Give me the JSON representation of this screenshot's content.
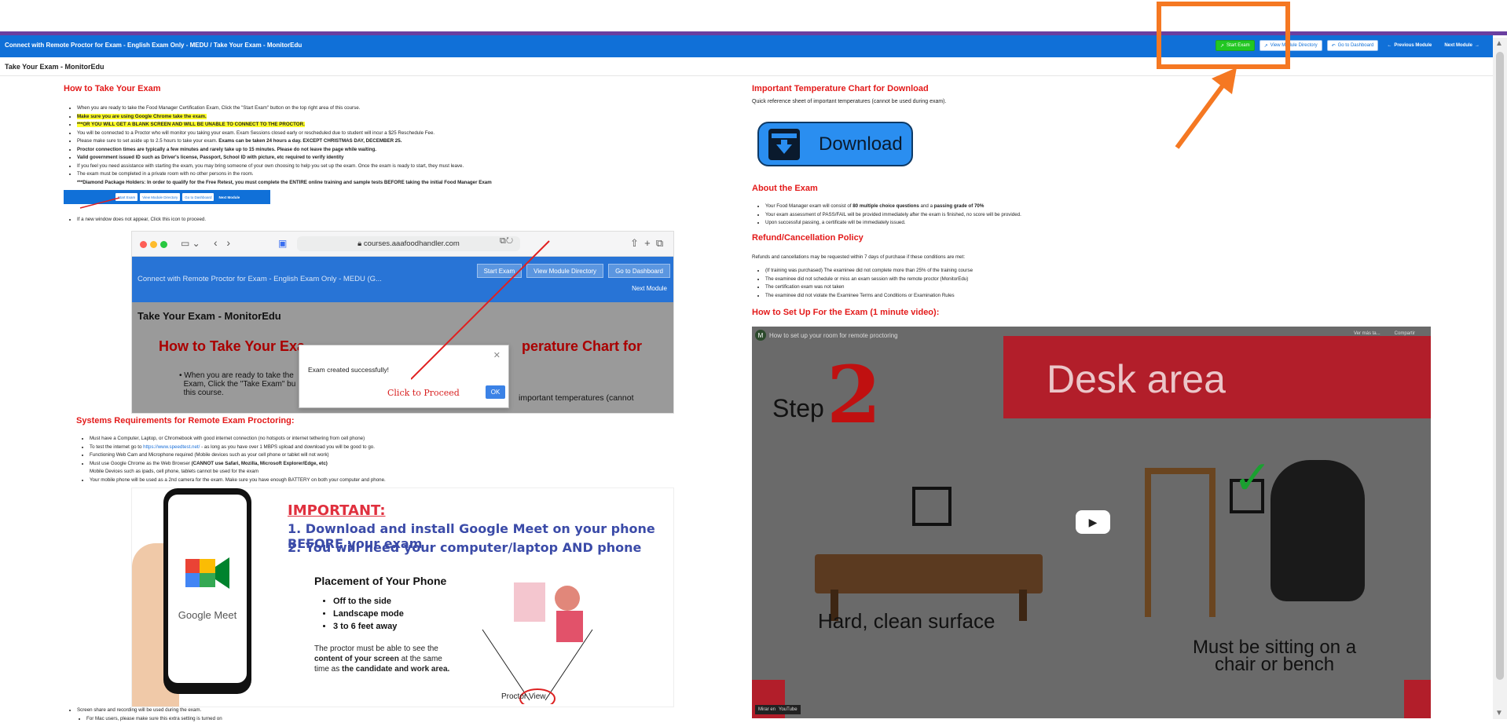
{
  "header": {
    "course_title": "Connect with Remote Proctor for Exam - English Exam Only - MEDU / Take Your Exam - MonitorEdu",
    "buttons": {
      "start_exam": "Start Exam",
      "view_module_directory": "View Module Directory",
      "go_to_dashboard": "Go to Dashboard",
      "previous_module": "Previous Module",
      "next_module": "Next Module"
    }
  },
  "page_title": "Take Your Exam - MonitorEdu",
  "left": {
    "how_to_heading": "How to Take Your Exam",
    "how_to_bullets": [
      "When you are ready to take the Food Manager Certification Exam, Click the \"Start Exam\" button on the top right area of this course.",
      "Make sure you are using Google Chrome take the exam.",
      "***OR YOU WILL GET A BLANK SCREEN AND WILL BE UNABLE TO CONNECT TO THE PROCTOR.",
      "You will be connected to a Proctor who will monitor you taking your exam. Exam Sessions closed early or rescheduled due to student will incur a $25 Reschedule Fee.",
      "Please make sure to set aside up to 2.5 hours to take your exam.",
      "Exams can be taken 24 hours a day. EXCEPT CHRISTMAS DAY, DECEMBER 25.",
      "Proctor connection times are typically a few minutes and rarely take up to 15 minutes. Please do not leave the page while waiting.",
      "Valid government issued ID such as Driver's license, Passport, School ID with picture, etc required to verify identity",
      "If you feel you need assistance with starting the exam, you may bring someone of your own choosing to help you set up the exam. Once the exam is ready to start, they must leave.",
      "The exam must be completed in a private room with no other persons in the room.",
      "***Diamond Package Holders: In order to qualify for the Free Retest, you must complete the ENTIRE online training and sample tests BEFORE taking the initial Food Manager Exam"
    ],
    "mini_toolbar": {
      "start_exam": "Start Exam",
      "view_module_directory": "View Module Directory",
      "go_to_dashboard": "Go to Dashboard",
      "next_module": "Next Module"
    },
    "new_window_note": "If a new window does not appear, Click this icon to proceed.",
    "browser": {
      "url": "courses.aaafoodhandler.com",
      "blue_title": "Connect with Remote Proctor for Exam - English Exam Only - MEDU (G...",
      "start_exam": "Start Exam",
      "view_module_directory": "View Module Directory",
      "go_to_dashboard": "Go to Dashboard",
      "next_module": "Next Module",
      "page_title": "Take Your Exam - MonitorEdu",
      "h_left": "How to Take Your Exa",
      "h_right": "perature Chart for",
      "text_left": "When you are ready to take the",
      "text_left2": "Exam, Click the \"Take Exam\" bu",
      "text_left3": "this course.",
      "text_right": "important temperatures (cannot",
      "dialog_message": "Exam created successfully!",
      "dialog_annotation": "Click to Proceed",
      "dialog_ok": "OK"
    },
    "system_heading": "Systems Requirements for Remote Exam Proctoring:",
    "system_bullets": [
      "Must have a Computer, Laptop, or Chromebook with good internet connection (no hotspots or internet tethering from cell phone)",
      "To test the internet go to",
      "https://www.speedtest.net/",
      "- as long as you have over 1 MBPS upload and download you will be good to go.",
      "Functioning Web Cam and Microphone required (Mobile devices such as your cell phone or tablet will not work)",
      "Must use Google Chrome as the Web Browser",
      "(CANNOT use Safari, Mozilla, Microsoft Explorer/Edge, etc)",
      "Mobile Devices such as ipads, cell phone, tablets cannot be used for the exam",
      "Your mobile phone will be used as a 2nd camera for the exam. Make sure you have enough BATTERY on both your computer and phone."
    ],
    "phone_image": {
      "google_meet": "Google Meet",
      "important": "IMPORTANT:",
      "line1": "1. Download and install Google Meet on your phone BEFORE your exam",
      "line2": "2. You will need your computer/laptop AND phone",
      "placement_title": "Placement of Your Phone",
      "placement_items": [
        "Off to the side",
        "Landscape mode",
        "3 to 6 feet away"
      ],
      "note_part1": "The proctor must be able to see the",
      "note_bold1": "content of your screen",
      "note_part2": "at the same time as",
      "note_bold2": "the candidate and work area.",
      "proctor_view": "Proctor View"
    },
    "bottom_bullets": [
      "Screen share and recording will be used during the exam.",
      "For Mac users, please make sure this extra setting is turned on"
    ]
  },
  "right": {
    "temp_heading": "Important Temperature Chart for Download",
    "temp_note": "Quick reference sheet of important temperatures (cannot be used during exam).",
    "download_label": "Download",
    "about_heading": "About the Exam",
    "about_bullets": [
      "Your Food Manager exam will consist of",
      "80 multiple choice questions",
      "and a",
      "passing grade of 70%",
      "Your exam assessment of PASS/FAIL will be provided immediately after the exam is finished, no score will be provided.",
      "Upon successful passing, a certificate will be immediately issued."
    ],
    "refund_heading": "Refund/Cancellation Policy",
    "refund_note": "Refunds and cancellations may be requested within 7 days of purchase if these conditions are met:",
    "refund_bullets": [
      "(If training was purchased) The examinee did not complete more than 25% of the training course",
      "The examinee did not schedule or miss an exam session with the remote proctor (MonitorEdu)",
      "The certification exam was not taken",
      "The examinee did not violate the Examinee Terms and Conditions or Examination Rules"
    ],
    "setup_heading": "How to Set Up For the Exam (1 minute video):",
    "video": {
      "channel_initial": "M",
      "title": "How to set up your room for remote proctoring",
      "watch_later": "Ver más ta...",
      "share": "Compartir",
      "banner": "Desk area",
      "step": "Step",
      "step_number": "2",
      "hard_surface": "Hard, clean surface",
      "must_sit": "Must be sitting on a chair or bench",
      "watch_on": "Mirar en",
      "youtube": "YouTube"
    }
  },
  "colors": {
    "accent_blue": "#1070d8",
    "heading_red": "#e31a1a",
    "start_green": "#22c722",
    "annotation_orange": "#f57822",
    "highlight_yellow": "#ffff2a"
  }
}
